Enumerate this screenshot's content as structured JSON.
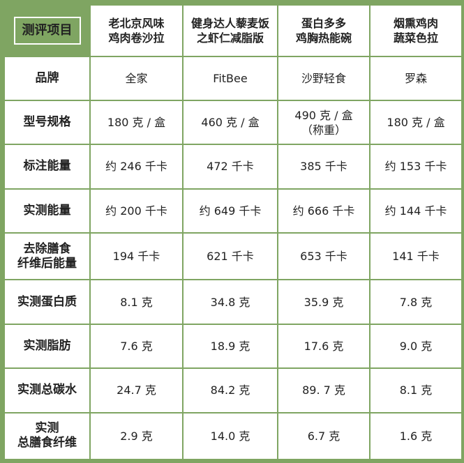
{
  "header": {
    "corner": "测评项目",
    "products": [
      {
        "line1": "老北京风味",
        "line2": "鸡肉卷沙拉"
      },
      {
        "line1": "健身达人藜麦饭",
        "line2": "之虾仁减脂版"
      },
      {
        "line1": "蛋白多多",
        "line2": "鸡胸热能碗"
      },
      {
        "line1": "烟熏鸡肉",
        "line2": "蔬菜色拉"
      }
    ]
  },
  "rows": [
    {
      "label": [
        "品牌"
      ],
      "values": [
        [
          "全家"
        ],
        [
          "FitBee"
        ],
        [
          "沙野轻食"
        ],
        [
          "罗森"
        ]
      ]
    },
    {
      "label": [
        "型号规格"
      ],
      "values": [
        [
          "180 克 / 盒"
        ],
        [
          "460 克 / 盒"
        ],
        [
          "490 克 / 盒",
          "（称重）"
        ],
        [
          "180 克 / 盒"
        ]
      ]
    },
    {
      "label": [
        "标注能量"
      ],
      "values": [
        [
          "约 246 千卡"
        ],
        [
          "472 千卡"
        ],
        [
          "385 千卡"
        ],
        [
          "约 153 千卡"
        ]
      ]
    },
    {
      "label": [
        "实测能量"
      ],
      "values": [
        [
          "约 200 千卡"
        ],
        [
          "约 649 千卡"
        ],
        [
          "约 666 千卡"
        ],
        [
          "约 144 千卡"
        ]
      ]
    },
    {
      "label": [
        "去除膳食",
        "纤维后能量"
      ],
      "values": [
        [
          "194 千卡"
        ],
        [
          "621 千卡"
        ],
        [
          "653 千卡"
        ],
        [
          "141 千卡"
        ]
      ]
    },
    {
      "label": [
        "实测蛋白质"
      ],
      "values": [
        [
          "8.1 克"
        ],
        [
          "34.8 克"
        ],
        [
          "35.9 克"
        ],
        [
          "7.8 克"
        ]
      ]
    },
    {
      "label": [
        "实测脂肪"
      ],
      "values": [
        [
          "7.6 克"
        ],
        [
          "18.9 克"
        ],
        [
          "17.6 克"
        ],
        [
          "9.0 克"
        ]
      ]
    },
    {
      "label": [
        "实测总碳水"
      ],
      "values": [
        [
          "24.7 克"
        ],
        [
          "84.2 克"
        ],
        [
          "89. 7 克"
        ],
        [
          "8.1 克"
        ]
      ]
    },
    {
      "label": [
        "实测",
        "总膳食纤维"
      ],
      "values": [
        [
          "2.9 克"
        ],
        [
          "14.0 克"
        ],
        [
          "6.7 克"
        ],
        [
          "1.6 克"
        ]
      ]
    }
  ],
  "colors": {
    "accent": "#7fa562",
    "text": "#222222",
    "background": "#ffffff"
  }
}
